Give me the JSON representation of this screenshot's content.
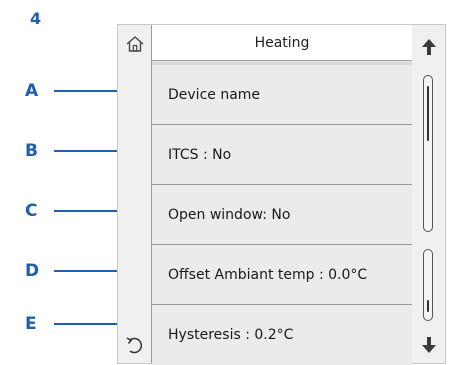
{
  "figure_number": "4",
  "screen": {
    "title": "Heating",
    "rows": [
      "Device name",
      "ITCS : No",
      "Open window: No",
      "Offset Ambiant temp : 0.0°C",
      "Hysteresis : 0.2°C"
    ]
  },
  "callouts": [
    "A",
    "B",
    "C",
    "D",
    "E"
  ],
  "icons": {
    "home": "home-icon",
    "back": "undo-arrow-icon",
    "up": "arrow-up-icon",
    "down": "arrow-down-icon"
  },
  "colors": {
    "callout": "#1e5fae",
    "panel": "#f0f0f0",
    "row_background": "#ebebeb",
    "header_background": "#ffffff"
  }
}
